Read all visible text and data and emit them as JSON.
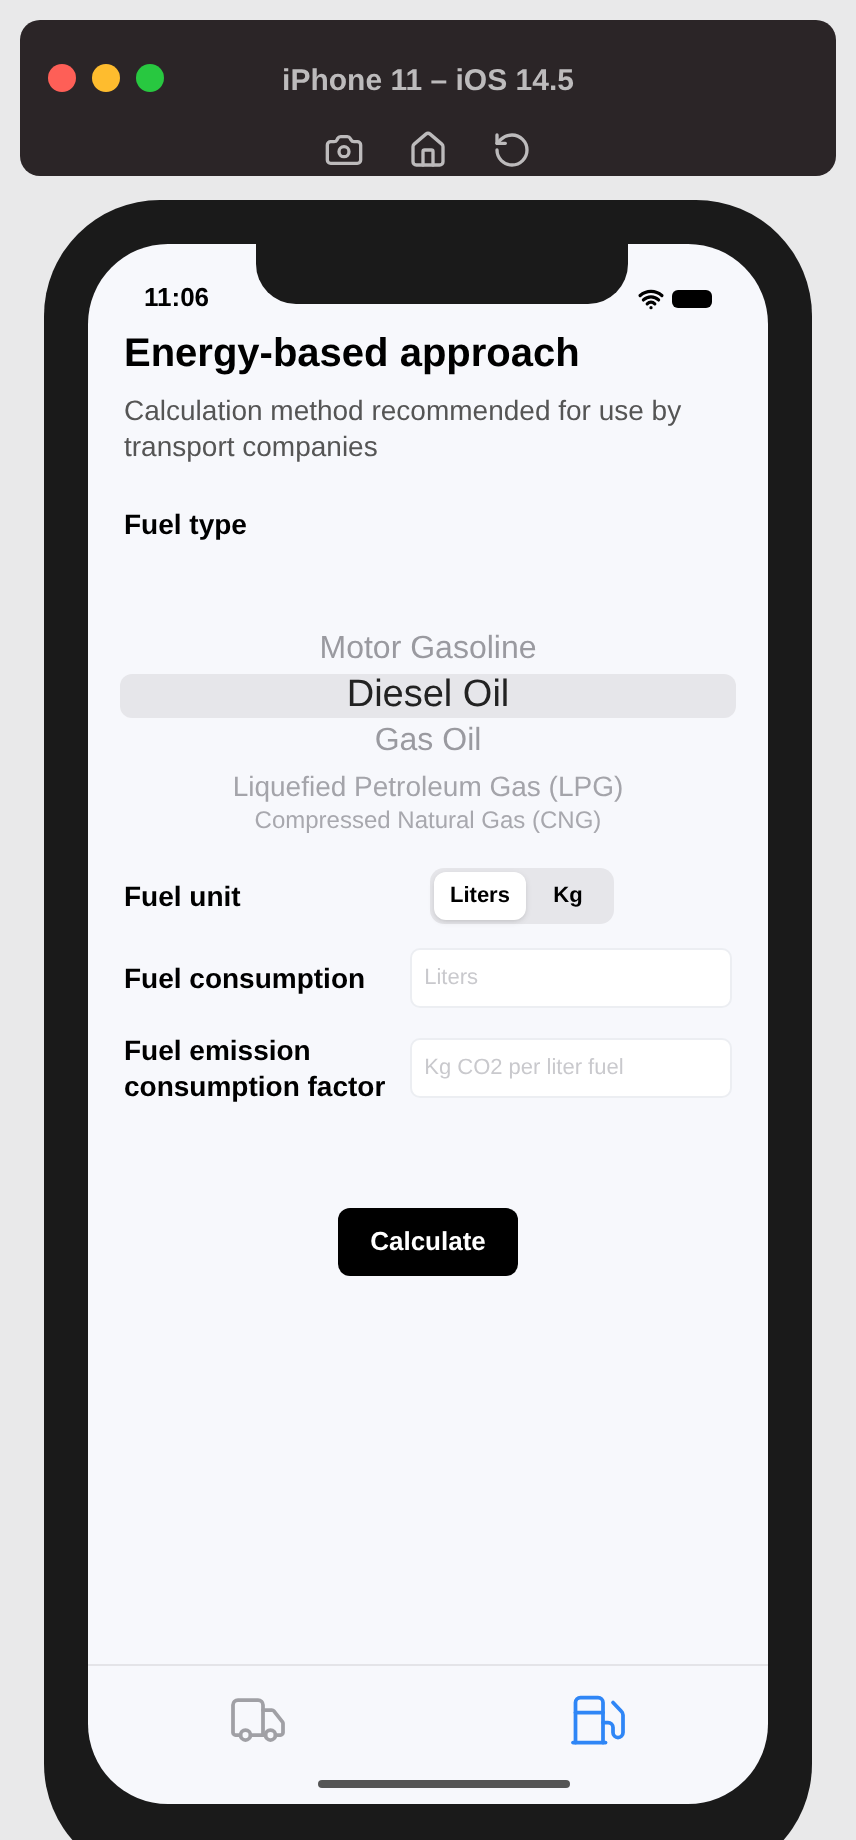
{
  "simulator": {
    "title": "iPhone 11 – iOS 14.5"
  },
  "status_bar": {
    "time": "11:06"
  },
  "header": {
    "title": "Energy-based approach",
    "subtitle": "Calculation method recommended for use by transport companies"
  },
  "fuel_type": {
    "label": "Fuel type",
    "options": [
      {
        "label": "Motor Gasoline",
        "selected": false
      },
      {
        "label": "Diesel Oil",
        "selected": true
      },
      {
        "label": "Gas Oil",
        "selected": false
      },
      {
        "label": "Liquefied Petroleum Gas (LPG)",
        "selected": false
      },
      {
        "label": "Compressed Natural Gas (CNG)",
        "selected": false
      }
    ]
  },
  "fuel_unit": {
    "label": "Fuel unit",
    "segments": [
      {
        "label": "Liters",
        "selected": true
      },
      {
        "label": "Kg",
        "selected": false
      }
    ]
  },
  "fields": [
    {
      "label": "Fuel consumption",
      "placeholder": "Liters"
    },
    {
      "label": "Fuel emission consumption factor",
      "placeholder": "Kg CO2 per liter fuel"
    }
  ],
  "button": {
    "label": "Calculate"
  },
  "tab_bar": [
    {
      "kind": "truck",
      "selected": false
    },
    {
      "kind": "fuel",
      "selected": true
    }
  ]
}
